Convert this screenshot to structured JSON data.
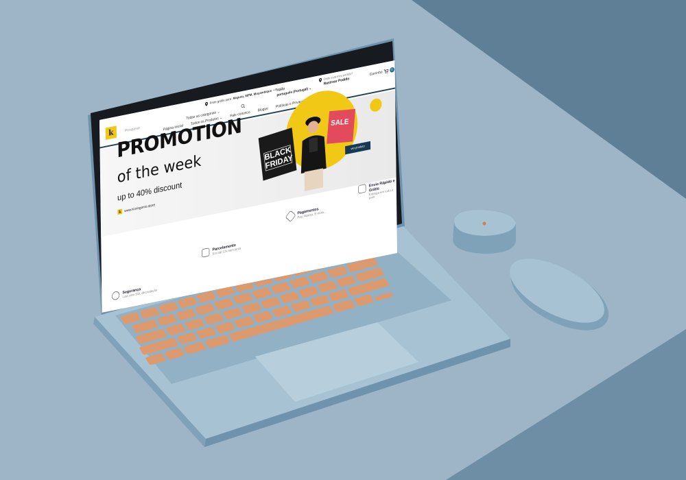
{
  "site": {
    "logo_letter": "k",
    "search_placeholder": "Pesquisar",
    "delivery_prefix": "Frete grátis para",
    "delivery_location": "Maputo, MPM, Moçambique",
    "delivery_suffix": "• Região",
    "language_label": "Idioma",
    "language_value": "português (Portugal)",
    "track_label": "Onde está meu pedido?",
    "track_value": "Rastrear Pedido",
    "cart_label": "Carrinho",
    "cart_count": "0",
    "categories_label": "Todas as categorias",
    "nav": [
      "Página Inicial",
      "Todos os Produtos",
      "Fale conosco",
      "Blogue",
      "Políticas e Privacidade"
    ],
    "hero": {
      "title": "PROMOTION",
      "subtitle": "of the week",
      "discount": "up to 40% discount",
      "website": "www.Koringomo.store",
      "bag_left_text": "BLACK FRIDAY",
      "bag_right_text": "SALE",
      "cta": "ver produto"
    },
    "features": [
      {
        "title": "Envio Rápido e Grátis",
        "subtitle": "Entrega em todo o país"
      },
      {
        "title": "Pagamentos",
        "subtitle": "Pay, Mpesa, E-mola..."
      },
      {
        "title": "Parcelamento",
        "subtitle": "Em até 12x sem juros"
      },
      {
        "title": "Segurança",
        "subtitle": "Loja com SSL de proteção"
      }
    ]
  },
  "colors": {
    "background": "#9db5c6",
    "laptop_body": "#a7c2d3",
    "keys": "#dd9a6f",
    "brand_yellow": "#f2c817",
    "brand_navy": "#173a52"
  }
}
